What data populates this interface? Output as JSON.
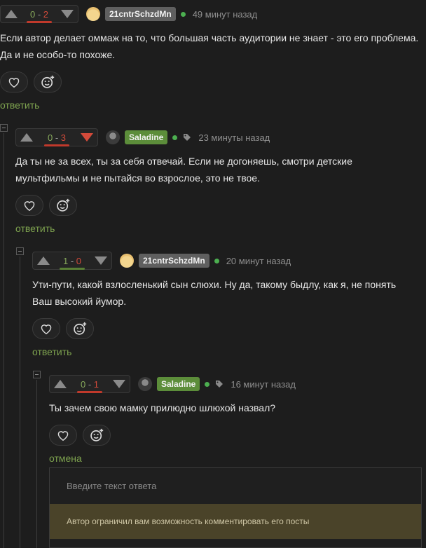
{
  "comments": [
    {
      "score_pos": "0",
      "score_neg": "2",
      "score_sep": " - ",
      "username": "21cntrSchzdMn",
      "time": "49 минут назад",
      "text_lines": [
        "Если автор делает оммаж на то, что большая часть аудитории не знает - это его проблема.",
        "Да и не особо-то похоже."
      ],
      "action_label": "ответить"
    },
    {
      "score_pos": "0",
      "score_neg": "3",
      "score_sep": " - ",
      "username": "Saladine",
      "time": "23 минуты назад",
      "text_lines": [
        "Да ты не за всех, ты за себя отвечай. Если не догоняешь, смотри детские",
        "мультфильмы и не пытайся во взрослое, это не твое."
      ],
      "action_label": "ответить"
    },
    {
      "score_pos": "1",
      "score_neg": "0",
      "score_sep": " - ",
      "username": "21cntrSchzdMn",
      "time": "20 минут назад",
      "text_lines": [
        "Ути-пути, какой взлосленький сын слюхи. Ну да, такому быдлу, как я, не понять",
        "Ваш высокий йумор."
      ],
      "action_label": "ответить"
    },
    {
      "score_pos": "0",
      "score_neg": "1",
      "score_sep": " - ",
      "username": "Saladine",
      "time": "16 минут назад",
      "text_lines": [
        "Ты зачем свою мамку прилюдно шлюхой назвал?"
      ],
      "action_label": "отмена"
    }
  ],
  "reply": {
    "placeholder": "Введите текст ответа",
    "notice": "Автор ограничил вам возможность комментировать его посты"
  },
  "colors": {
    "positive": "#86a85b",
    "negative": "#d24a3a",
    "accent": "#7ea34f",
    "username_green": "#5c8d3a",
    "username_grey": "#5f5f5f",
    "online": "#4caf50"
  },
  "icons": [
    "arrow-up-icon",
    "arrow-down-icon",
    "heart-icon",
    "emoji-plus-icon",
    "tag-icon",
    "collapse-icon"
  ]
}
